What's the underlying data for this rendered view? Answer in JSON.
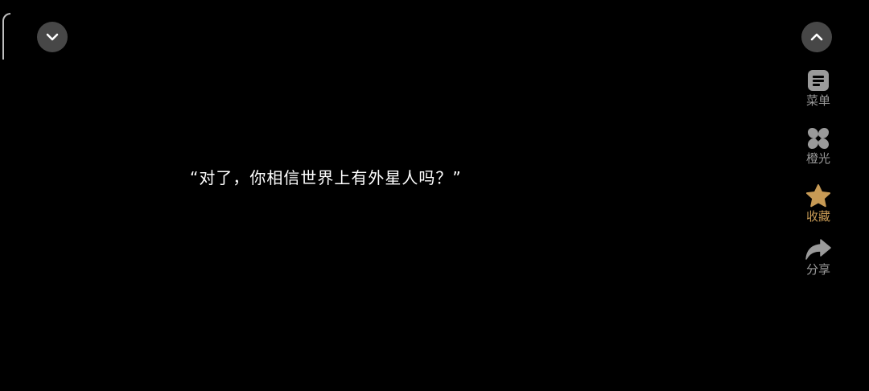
{
  "icons": {
    "collapse": "chevron-down-icon",
    "expand": "chevron-up-icon",
    "menu": "menu-icon",
    "light": "flower-icon",
    "favorite": "star-icon",
    "share": "share-arrow-icon"
  },
  "colors": {
    "background": "#000000",
    "circle_button": "#474747",
    "icon_gray": "#9a9a9a",
    "favorite_accent": "#c79a55",
    "text": "#ffffff"
  },
  "dialogue": {
    "text": "“对了，你相信世界上有外星人吗？”"
  },
  "sidebar": {
    "menu_label": "菜单",
    "light_label": "橙光",
    "favorite_label": "收藏",
    "share_label": "分享"
  }
}
